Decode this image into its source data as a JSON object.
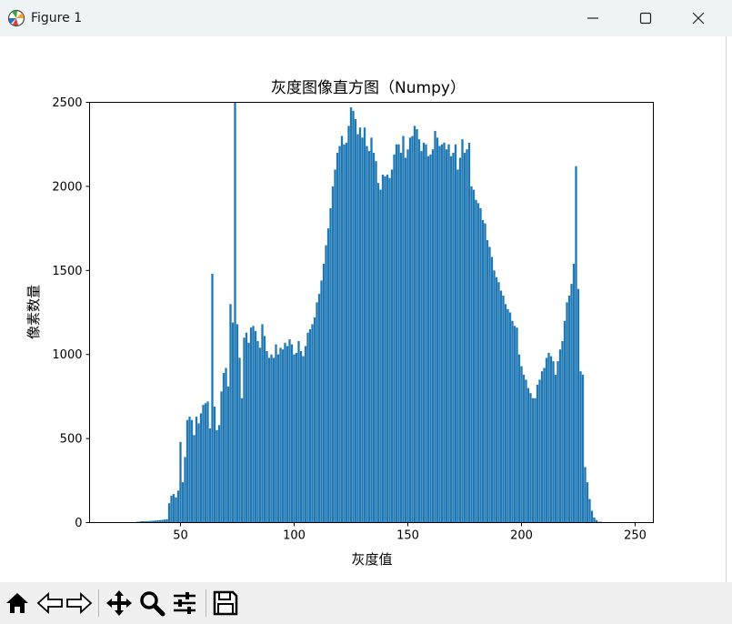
{
  "window": {
    "title": "Figure 1",
    "icon": "matplotlib-icon",
    "controls": [
      "minimize-icon",
      "maximize-icon",
      "close-icon"
    ]
  },
  "toolbar": {
    "buttons": [
      "home-icon",
      "back-icon",
      "forward-icon",
      "pan-icon",
      "zoom-icon",
      "configure-subplots-icon",
      "save-icon"
    ]
  },
  "chart_data": {
    "type": "bar",
    "title": "灰度图像直方图（Numpy）",
    "xlabel": "灰度值",
    "ylabel": "像素数量",
    "xlim": [
      10,
      258
    ],
    "ylim": [
      0,
      2500
    ],
    "xticks": [
      50,
      100,
      150,
      200,
      250
    ],
    "yticks": [
      0,
      500,
      1000,
      1500,
      2000,
      2500
    ],
    "grid": false,
    "bar_color": "#1f77b4",
    "x_start": 0,
    "values": [
      0,
      0,
      0,
      0,
      0,
      0,
      0,
      0,
      0,
      0,
      0,
      0,
      0,
      0,
      0,
      0,
      0,
      0,
      0,
      0,
      0,
      0,
      0,
      0,
      0,
      0,
      0,
      0,
      0,
      0,
      0,
      5,
      6,
      8,
      8,
      8,
      9,
      10,
      11,
      12,
      14,
      14,
      16,
      18,
      20,
      115,
      160,
      170,
      150,
      190,
      480,
      240,
      390,
      610,
      630,
      610,
      520,
      630,
      590,
      650,
      700,
      710,
      720,
      560,
      1480,
      690,
      550,
      580,
      780,
      890,
      920,
      810,
      1300,
      1190,
      2500,
      1180,
      980,
      740,
      1100,
      1130,
      1070,
      1160,
      1170,
      1140,
      1080,
      1040,
      1180,
      1110,
      1020,
      980,
      1000,
      980,
      1060,
      1000,
      1040,
      1030,
      1070,
      1050,
      1090,
      1060,
      1000,
      1010,
      1080,
      1020,
      990,
      1050,
      1130,
      1150,
      1180,
      1220,
      1310,
      1360,
      1440,
      1540,
      1650,
      1750,
      1870,
      2000,
      2100,
      2200,
      2240,
      2300,
      2250,
      2260,
      2360,
      2470,
      2450,
      2400,
      2310,
      2350,
      2290,
      2350,
      2240,
      2210,
      2290,
      2200,
      2150,
      2020,
      1980,
      2070,
      2060,
      2070,
      2050,
      2100,
      2190,
      2250,
      2250,
      2200,
      2300,
      2170,
      2220,
      2290,
      2300,
      2360,
      2340,
      2280,
      2210,
      2260,
      2250,
      2180,
      2190,
      2220,
      2330,
      2290,
      2240,
      2250,
      2260,
      2220,
      2250,
      2180,
      2200,
      2250,
      2100,
      2170,
      2280,
      2200,
      2220,
      2260,
      2000,
      1980,
      1920,
      1900,
      1870,
      1800,
      1780,
      1680,
      1640,
      1580,
      1500,
      1460,
      1430,
      1380,
      1350,
      1300,
      1270,
      1250,
      1200,
      1170,
      1160,
      1000,
      930,
      880,
      850,
      800,
      770,
      740,
      740,
      820,
      850,
      900,
      920,
      980,
      1010,
      990,
      960,
      880,
      960,
      1030,
      1080,
      1200,
      1310,
      1350,
      1420,
      1540,
      2120,
      1390,
      900,
      880,
      330,
      240,
      140,
      70,
      30,
      15,
      5,
      5,
      3,
      2,
      0,
      0,
      0,
      0,
      0,
      0,
      0,
      0,
      0,
      0
    ]
  }
}
